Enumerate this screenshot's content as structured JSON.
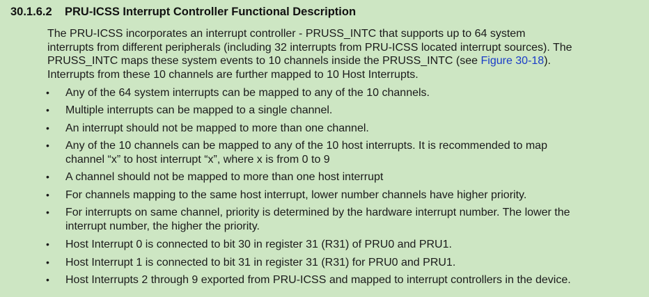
{
  "section": {
    "number": "30.1.6.2",
    "title": "PRU-ICSS Interrupt Controller Functional Description"
  },
  "intro": {
    "line1": "The PRU-ICSS incorporates an interrupt controller - PRUSS_INTC that supports up to 64 system",
    "line2": "interrupts from different peripherals (including 32 interrupts from PRU-ICSS located interrupt sources). The",
    "line3_before_link": "PRUSS_INTC maps these system events to 10 channels inside the PRUSS_INTC (see ",
    "line3_link": "Figure 30-18",
    "line3_after_link": ").",
    "line4": "Interrupts from these 10 channels are further mapped to 10 Host Interrupts."
  },
  "bullet_symbol": "•",
  "bullets": [
    {
      "line1": "Any of the 64 system interrupts can be mapped to any of the 10 channels.",
      "line2": ""
    },
    {
      "line1": "Multiple interrupts can be mapped to a single channel.",
      "line2": ""
    },
    {
      "line1": "An interrupt should not be mapped to more than one channel.",
      "line2": ""
    },
    {
      "line1": "Any of the 10 channels can be mapped to any of the 10 host interrupts. It is recommended to map",
      "line2": "channel “x” to host interrupt “x”, where x is from 0 to 9"
    },
    {
      "line1": "A channel should not be mapped to more than one host interrupt",
      "line2": ""
    },
    {
      "line1": "For channels mapping to the same host interrupt, lower number channels have higher priority.",
      "line2": ""
    },
    {
      "line1": "For interrupts on same channel, priority is determined by the hardware interrupt number. The lower the",
      "line2": "interrupt number, the higher the priority."
    },
    {
      "line1": "Host Interrupt 0 is connected to bit 30 in register 31 (R31) of PRU0 and PRU1.",
      "line2": ""
    },
    {
      "line1": "Host Interrupt 1 is connected to bit 31 in register 31 (R31) for PRU0 and PRU1.",
      "line2": ""
    },
    {
      "line1": "Host Interrupts 2 through 9 exported from PRU-ICSS and mapped to interrupt controllers in the device.",
      "line2": ""
    }
  ]
}
